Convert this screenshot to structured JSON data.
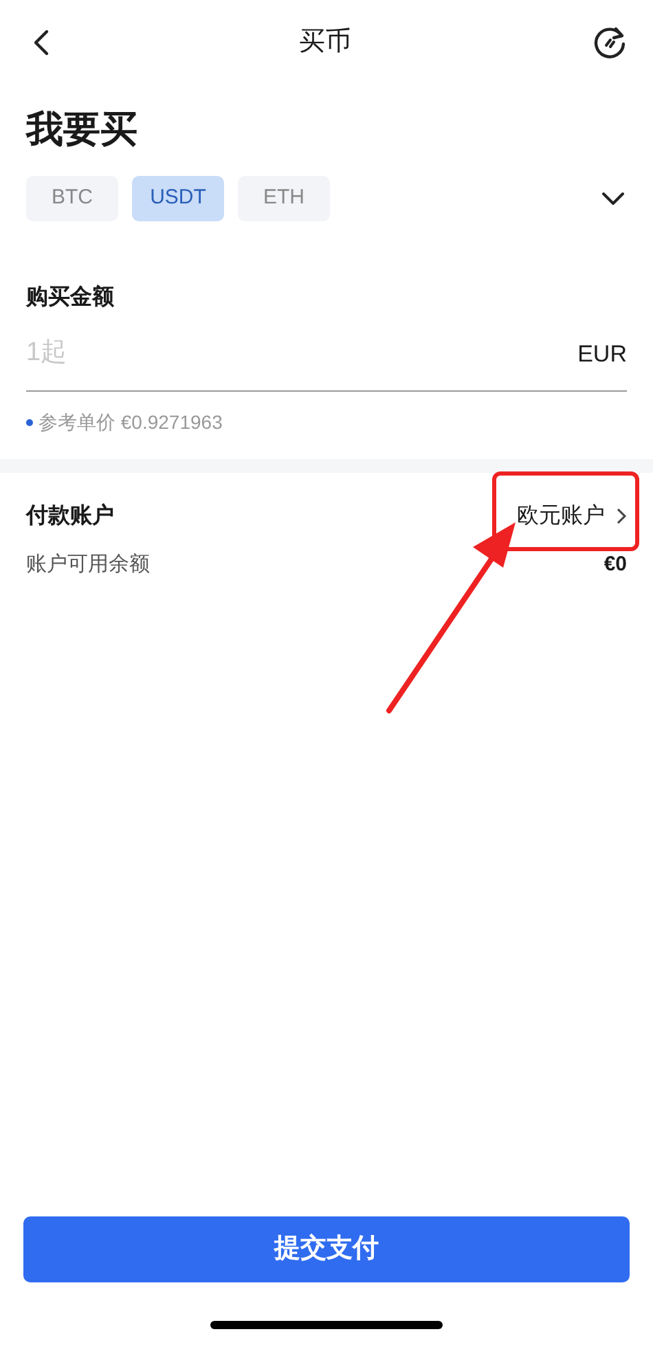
{
  "header": {
    "title": "买币"
  },
  "heading": "我要买",
  "coins": [
    {
      "label": "BTC",
      "selected": false
    },
    {
      "label": "USDT",
      "selected": true
    },
    {
      "label": "ETH",
      "selected": false
    }
  ],
  "amount": {
    "label": "购买金额",
    "placeholder": "1起",
    "currency": "EUR",
    "reference": "参考单价 €0.9271963"
  },
  "payment": {
    "label": "付款账户",
    "account": "欧元账户",
    "balance_label": "账户可用余额",
    "balance": "€0"
  },
  "submit": "提交支付"
}
